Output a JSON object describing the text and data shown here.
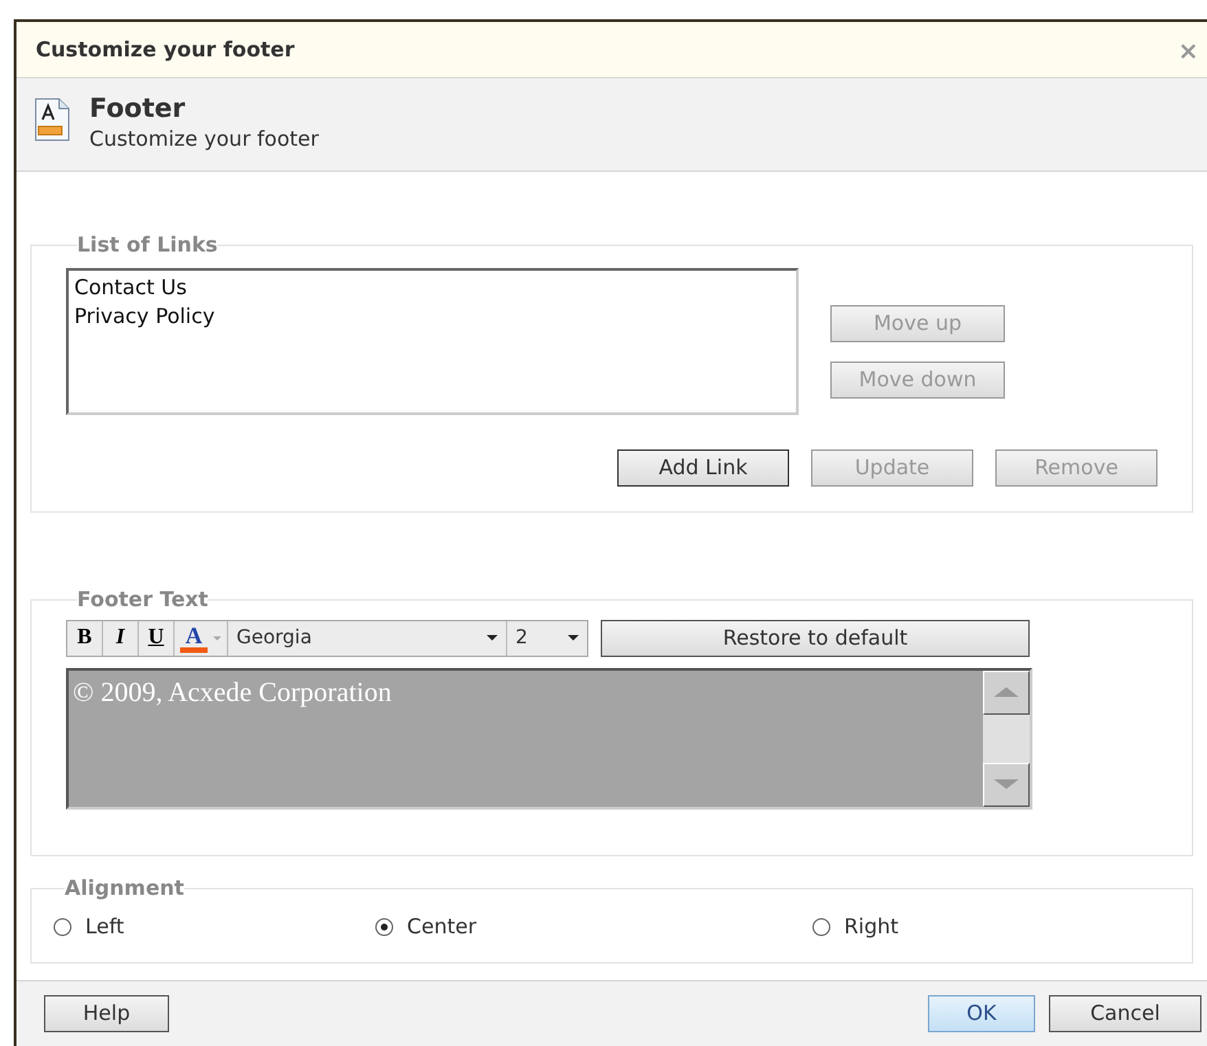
{
  "window": {
    "title": "Customize your footer",
    "close": "×"
  },
  "header": {
    "title": "Footer",
    "subtitle": "Customize your footer"
  },
  "links_group": {
    "legend": "List of Links",
    "links": [
      {
        "label": "Contact Us",
        "selected": false
      },
      {
        "label": "Privacy Policy",
        "selected": false
      }
    ],
    "side_buttons": [
      {
        "label": "Move up",
        "disabled": true
      },
      {
        "label": "Move down",
        "disabled": true
      }
    ],
    "buttons": [
      {
        "label": "Add Link",
        "disabled": false
      },
      {
        "label": "Update",
        "disabled": true
      },
      {
        "label": "Remove",
        "disabled": true
      }
    ]
  },
  "footer_text": {
    "legend": "Footer Text",
    "toolbar": [
      {
        "kind": "bold",
        "label": "B"
      },
      {
        "kind": "italic",
        "label": "I"
      },
      {
        "kind": "underline",
        "label": "U"
      },
      {
        "kind": "color",
        "label": "A"
      }
    ],
    "font": "Georgia",
    "size": "2",
    "restore": "Restore to default",
    "editor": {
      "value": "© 2009, Acxede Corporation",
      "disabled": true
    }
  },
  "alignment": {
    "legend": "Alignment",
    "options": [
      {
        "label": "Left",
        "selected": false
      },
      {
        "label": "Center",
        "selected": true
      },
      {
        "label": "Right",
        "selected": false
      }
    ]
  },
  "dialog_buttons": [
    {
      "label": "Help",
      "default": false
    },
    {
      "label": "OK",
      "default": true
    },
    {
      "label": "Cancel",
      "default": false
    }
  ]
}
